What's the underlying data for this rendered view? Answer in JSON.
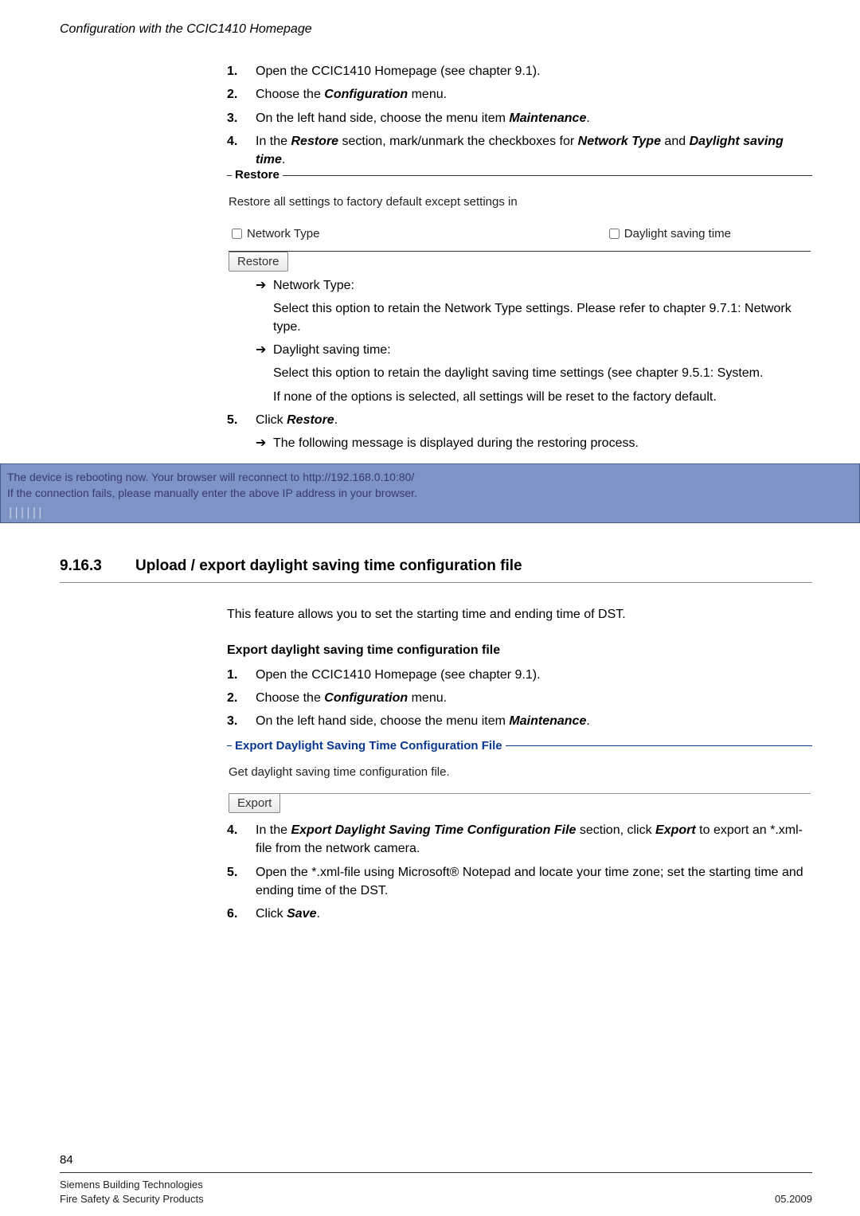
{
  "header": {
    "running": "Configuration with the CCIC1410 Homepage"
  },
  "top_steps": [
    {
      "n": "1.",
      "t": "Open the CCIC1410 Homepage (see chapter 9.1)."
    },
    {
      "n": "2.",
      "t_pre": "Choose the ",
      "bi": "Configuration",
      "t_post": " menu."
    },
    {
      "n": "3.",
      "t_pre": "On the left hand side, choose the menu item ",
      "bi": "Maintenance",
      "t_post": "."
    },
    {
      "n": "4.",
      "t_pre": "In the ",
      "bi": "Restore",
      "t_mid": " section, mark/unmark the checkboxes for ",
      "bi2": "Network Type",
      "t_mid2": " and ",
      "bi3": "Daylight saving time",
      "t_post": "."
    }
  ],
  "restore_box": {
    "legend": "Restore",
    "line": "Restore all settings to factory default except settings in",
    "cb1": "Network Type",
    "cb2": "Daylight saving time",
    "btn": "Restore"
  },
  "bullets": {
    "b1": "Network Type:",
    "b1_desc": "Select this option to retain the Network Type settings. Please refer to chapter 9.7.1: Network type.",
    "b2": "Daylight saving time:",
    "b2_desc": "Select this option to retain the daylight saving time settings (see chapter 9.5.1: System.",
    "b2_desc2": "If none of the options is selected, all settings will be reset to the factory default."
  },
  "step5": {
    "n": "5.",
    "t_pre": "Click ",
    "bi": "Restore",
    "t_post": "."
  },
  "step5_sub": "The following message is displayed during the restoring process.",
  "banner": {
    "l1": "The device is rebooting now. Your browser will reconnect to http://192.168.0.10:80/",
    "l2": "If the connection fails, please manually enter the above IP address in your browser.",
    "prog": "||||||"
  },
  "section": {
    "num": "9.16.3",
    "title": "Upload / export daylight saving time configuration file"
  },
  "intro": "This feature allows you to set the starting time and ending time of DST.",
  "subheading": "Export daylight saving time configuration file",
  "mid_steps": [
    {
      "n": "1.",
      "t": "Open the CCIC1410 Homepage (see chapter 9.1)."
    },
    {
      "n": "2.",
      "t_pre": "Choose the ",
      "bi": "Configuration",
      "t_post": " menu."
    },
    {
      "n": "3.",
      "t_pre": "On the left hand side, choose the menu item ",
      "bi": "Maintenance",
      "t_post": "."
    }
  ],
  "export_box": {
    "legend": "Export Daylight Saving Time Configuration File",
    "line": "Get daylight saving time configuration file.",
    "btn": "Export"
  },
  "end_steps": [
    {
      "n": "4.",
      "t_pre": "In the ",
      "bi": "Export Daylight Saving Time Configuration File",
      "t_mid": " section, click ",
      "bi2": "Export",
      "t_post": " to export an *.xml-file from the network camera."
    },
    {
      "n": "5.",
      "t": "Open the *.xml-file using Microsoft® Notepad and locate your time zone; set the starting time and ending time of the DST."
    },
    {
      "n": "6.",
      "t_pre": "Click ",
      "bi": "Save",
      "t_post": "."
    }
  ],
  "footer": {
    "page": "84",
    "l1": "Siemens Building Technologies",
    "l2": "Fire Safety & Security Products",
    "date": "05.2009"
  }
}
